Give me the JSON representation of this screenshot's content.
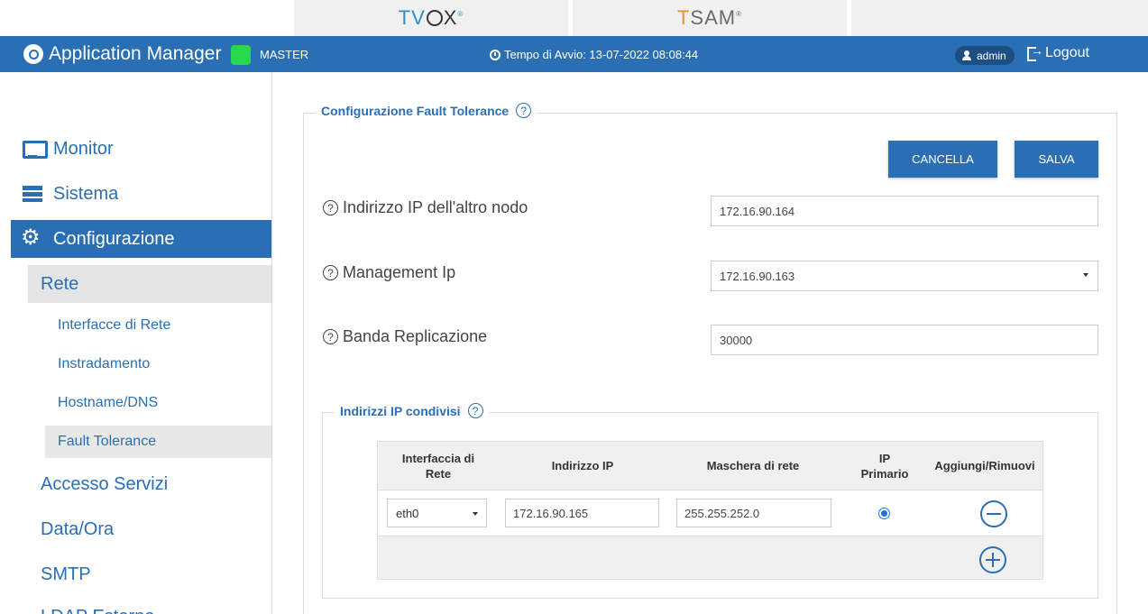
{
  "top_tabs": {
    "tvox": {
      "t": "T",
      "v": "V",
      "x": "X",
      "reg": "®"
    },
    "tsam": {
      "t": "T",
      "rest": "SAM",
      "reg": "®"
    }
  },
  "header": {
    "app_title": "Application Manager",
    "status_label": "MASTER",
    "status_color": "#27d84e",
    "uptime": "Tempo di Avvio: 13-07-2022 08:08:44",
    "user": "admin",
    "logout": "Logout",
    "accent_color": "#2a6fb4"
  },
  "sidebar": {
    "items": [
      {
        "label": "Monitor",
        "icon": "monitor-icon"
      },
      {
        "label": "Sistema",
        "icon": "server-icon"
      },
      {
        "label": "Configurazione",
        "icon": "gears-icon",
        "active": true
      }
    ],
    "sub_items": [
      {
        "label": "Rete",
        "active": true
      },
      {
        "label": "Accesso Servizi"
      },
      {
        "label": "Data/Ora"
      },
      {
        "label": "SMTP"
      },
      {
        "label": "LDAP Esterno"
      }
    ],
    "rete_items": [
      {
        "label": "Interfacce di Rete"
      },
      {
        "label": "Instradamento"
      },
      {
        "label": "Hostname/DNS"
      },
      {
        "label": "Fault Tolerance",
        "active": true
      }
    ]
  },
  "main": {
    "section_title": "Configurazione Fault Tolerance",
    "help_glyph": "?",
    "cancel_label": "CANCELLA",
    "save_label": "SALVA",
    "fields": [
      {
        "label": "Indirizzo IP dell'altro nodo",
        "value": "172.16.90.164",
        "type": "text"
      },
      {
        "label": "Management Ip",
        "value": "172.16.90.163",
        "type": "select"
      },
      {
        "label": "Banda Replicazione",
        "value": "30000",
        "type": "text"
      }
    ],
    "shared_ips": {
      "title": "Indirizzi IP condivisi",
      "columns": [
        "Interfaccia di Rete",
        "Indirizzo IP",
        "Maschera di rete",
        "IP Primario",
        "Aggiungi/Rimuovi"
      ],
      "rows": [
        {
          "interface": "eth0",
          "ip": "172.16.90.165",
          "mask": "255.255.252.0",
          "primary": true
        }
      ]
    }
  }
}
